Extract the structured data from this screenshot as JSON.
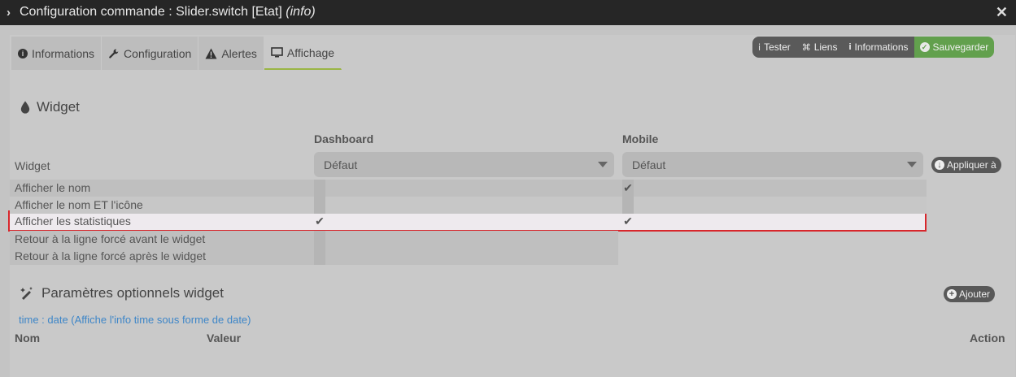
{
  "window": {
    "title_prefix": "Configuration commande : Slider.switch [Etat]",
    "title_italic": "(info)",
    "chevron_icon": "chevron-right-icon",
    "close_icon": "close-icon"
  },
  "tabs": [
    {
      "label": "Informations",
      "icon": "info-circle-icon"
    },
    {
      "label": "Configuration",
      "icon": "wrench-icon"
    },
    {
      "label": "Alertes",
      "icon": "warning-icon"
    },
    {
      "label": "Affichage",
      "icon": "monitor-icon",
      "active": true
    }
  ],
  "toolbar": {
    "tester": "Tester",
    "liens": "Liens",
    "informations": "Informations",
    "sauvegarder": "Sauvegarder"
  },
  "widget_section": {
    "title": "Widget",
    "col_dashboard": "Dashboard",
    "col_mobile": "Mobile",
    "widget_label": "Widget",
    "dashboard_select": "Défaut",
    "mobile_select": "Défaut",
    "apply_button": "Appliquer à",
    "rows": [
      {
        "label": "Afficher le nom",
        "dashboard": false,
        "mobile": true
      },
      {
        "label": "Afficher le nom ET l'icône",
        "dashboard": false,
        "mobile": false
      },
      {
        "label": "Afficher les statistiques",
        "dashboard": true,
        "mobile": true
      },
      {
        "label": "Retour à la ligne forcé avant le widget",
        "dashboard": false
      },
      {
        "label": "Retour à la ligne forcé après le widget",
        "dashboard": false
      }
    ]
  },
  "params_section": {
    "title": "Paramètres optionnels widget",
    "add_button": "Ajouter",
    "hint": "time : date (Affiche l'info time sous forme de date)",
    "col_nom": "Nom",
    "col_valeur": "Valeur",
    "col_action": "Action"
  },
  "colors": {
    "accent_green": "#62a04d",
    "highlight_border": "#d8262b",
    "link_blue": "#3e86c8"
  }
}
